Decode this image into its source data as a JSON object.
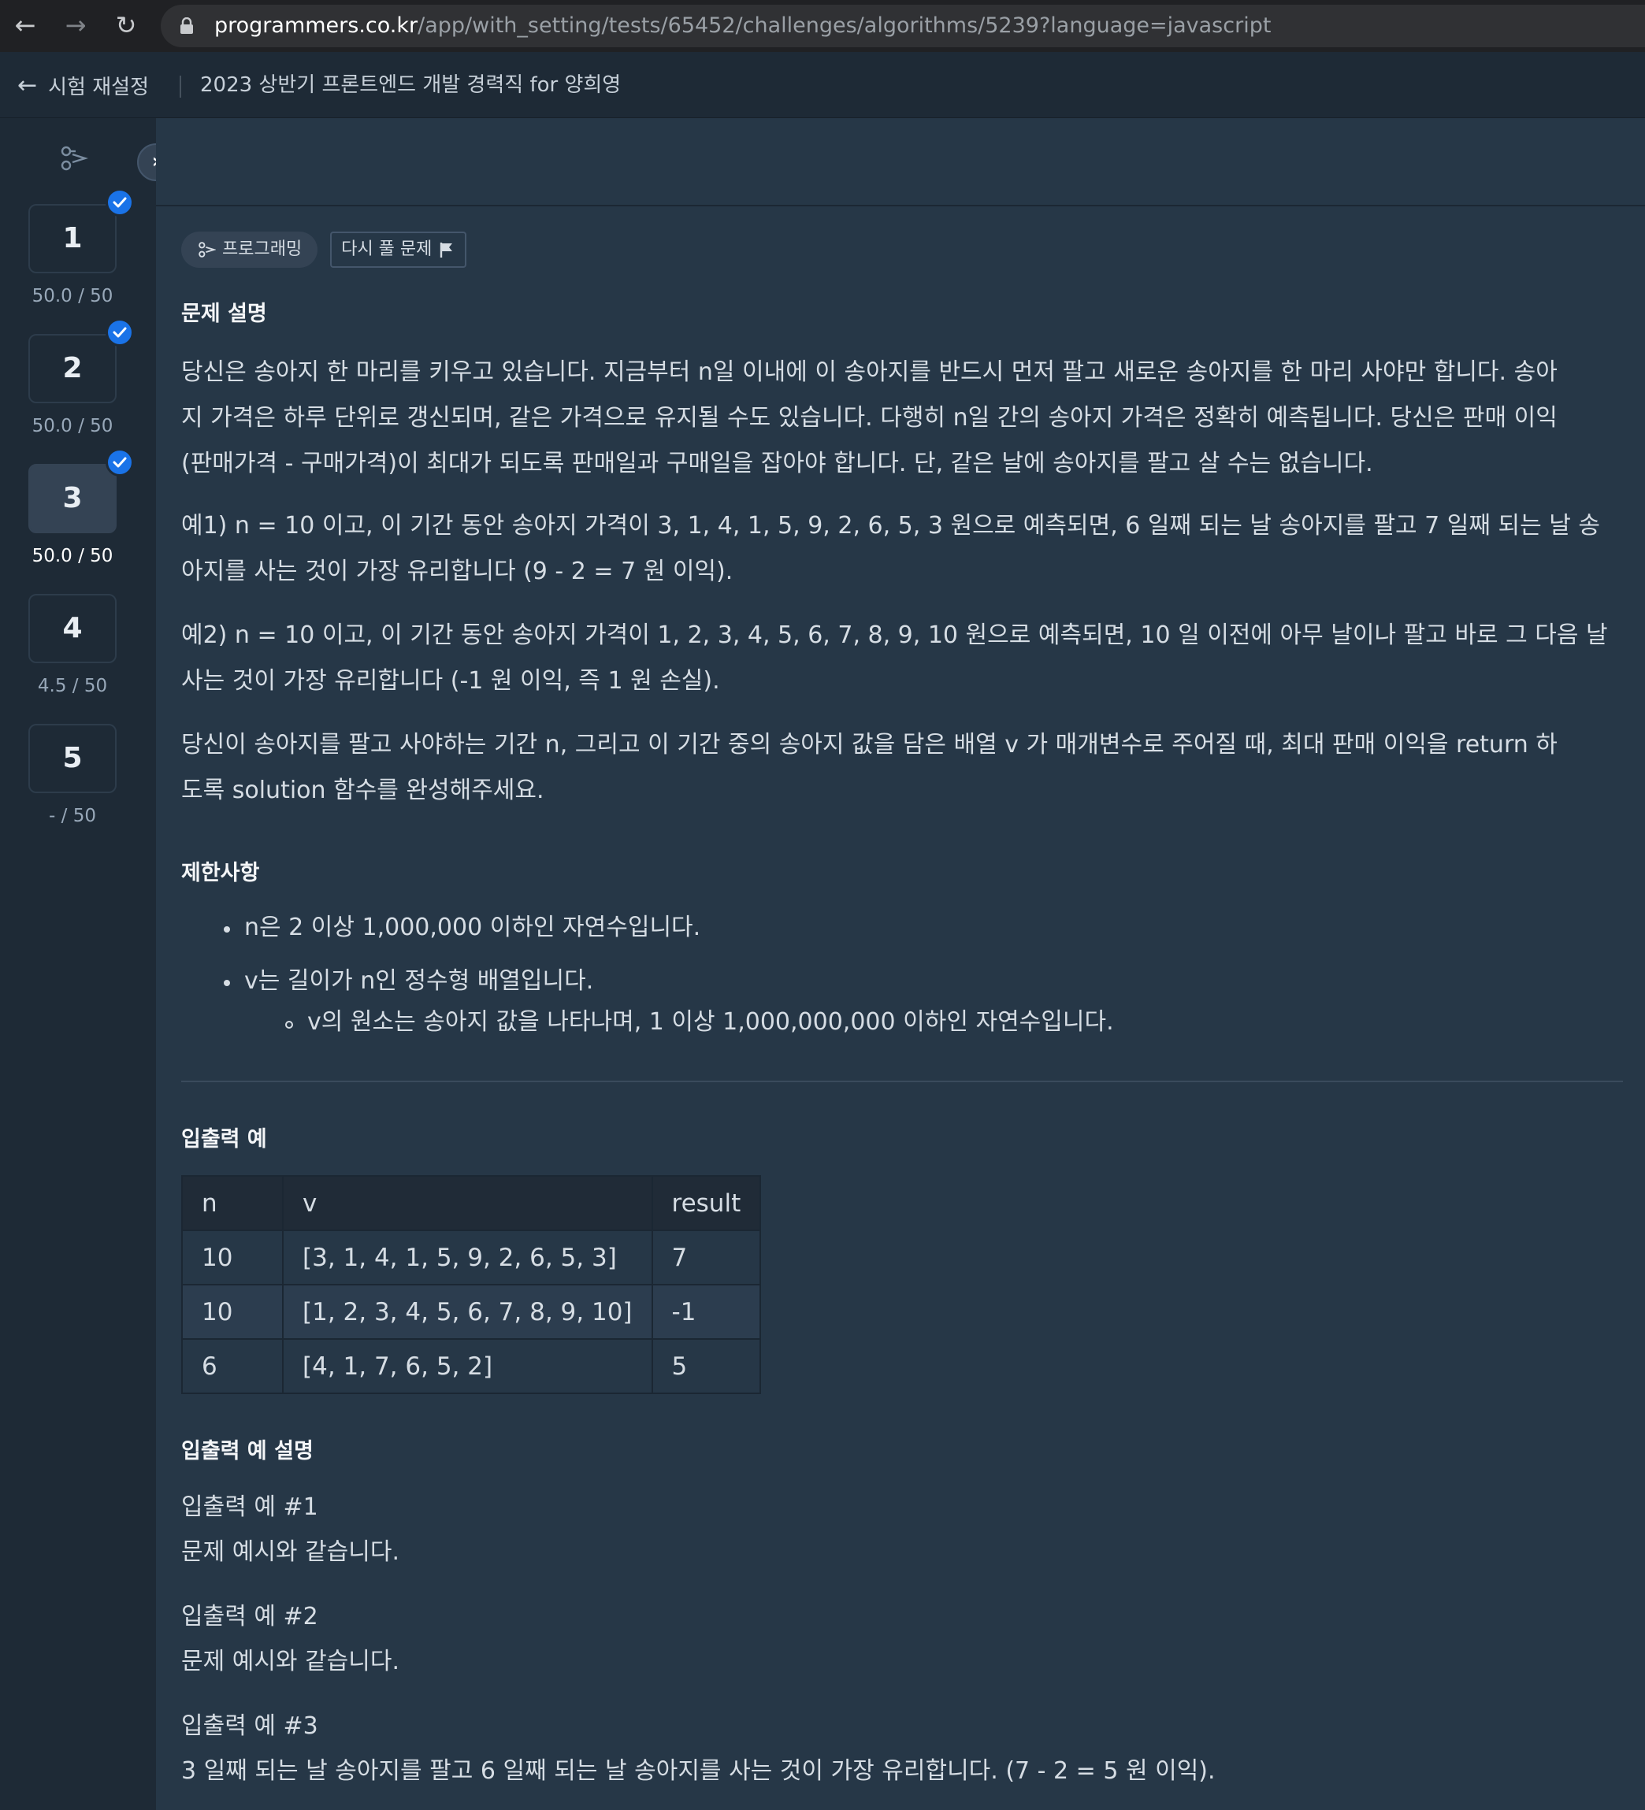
{
  "browser": {
    "url_host": "programmers.co.kr",
    "url_path": "/app/with_setting/tests/65452/challenges/algorithms/5239?language=javascript"
  },
  "header": {
    "back_label": "시험 재설정",
    "exam_title": "2023 상반기 프론트엔드 개발 경력직 for 양희영"
  },
  "sidebar": {
    "questions": [
      {
        "number": "1",
        "score": "50.0 / 50",
        "completed": true,
        "active": false
      },
      {
        "number": "2",
        "score": "50.0 / 50",
        "completed": true,
        "active": false
      },
      {
        "number": "3",
        "score": "50.0 / 50",
        "completed": true,
        "active": true
      },
      {
        "number": "4",
        "score": "4.5 / 50",
        "completed": false,
        "active": false
      },
      {
        "number": "5",
        "score": "- / 50",
        "completed": false,
        "active": false
      }
    ]
  },
  "tags": {
    "category": "프로그래밍",
    "retry": "다시 풀 문제"
  },
  "problem": {
    "title": "문제 설명",
    "lines": [
      "당신은 송아지 한 마리를 키우고 있습니다. 지금부터 n일 이내에 이 송아지를 반드시 먼저 팔고 새로운 송아지를 한 마리 사야만 합니다. 송아",
      "지 가격은 하루 단위로 갱신되며, 같은 가격으로 유지될 수도 있습니다. 다행히 n일 간의 송아지 가격은 정확히 예측됩니다. 당신은 판매 이익",
      "(판매가격 - 구매가격)이 최대가 되도록 판매일과 구매일을 잡아야 합니다. 단, 같은 날에 송아지를 팔고 살 수는 없습니다."
    ],
    "example1": [
      "예1) n = 10 이고, 이 기간 동안 송아지 가격이 3, 1, 4, 1, 5, 9, 2, 6, 5, 3 원으로 예측되면, 6 일째 되는 날 송아지를 팔고 7 일째 되는 날 송",
      "아지를 사는 것이 가장 유리합니다 (9 - 2 = 7 원 이익)."
    ],
    "example2": [
      "예2) n = 10 이고, 이 기간 동안 송아지 가격이 1, 2, 3, 4, 5, 6, 7, 8, 9, 10 원으로 예측되면, 10 일 이전에 아무 날이나 팔고 바로 그 다음 날",
      "사는 것이 가장 유리합니다 (-1 원 이익, 즉 1 원 손실)."
    ],
    "task": [
      "당신이 송아지를 팔고 사야하는 기간 n, 그리고 이 기간 중의 송아지 값을 담은 배열 v 가 매개변수로 주어질 때, 최대 판매 이익을 return 하",
      "도록 solution 함수를 완성해주세요."
    ]
  },
  "constraints": {
    "title": "제한사항",
    "items": [
      "n은 2 이상 1,000,000 이하인 자연수입니다.",
      "v는 길이가 n인 정수형 배열입니다."
    ],
    "subitem": "v의 원소는 송아지 값을 나타나며, 1 이상 1,000,000,000 이하인 자연수입니다."
  },
  "io_example": {
    "title": "입출력 예",
    "headers": [
      "n",
      "v",
      "result"
    ],
    "rows": [
      [
        "10",
        "[3, 1, 4, 1, 5, 9, 2, 6, 5, 3]",
        "7"
      ],
      [
        "10",
        "[1, 2, 3, 4, 5, 6, 7, 8, 9, 10]",
        "-1"
      ],
      [
        "6",
        "[4, 1, 7, 6, 5, 2]",
        "5"
      ]
    ]
  },
  "io_explanation": {
    "title": "입출력 예 설명",
    "items": [
      {
        "label": "입출력 예 #1",
        "text": "문제 예시와 같습니다."
      },
      {
        "label": "입출력 예 #2",
        "text": "문제 예시와 같습니다."
      },
      {
        "label": "입출력 예 #3",
        "text": "3 일째 되는 날 송아지를 팔고 6 일째 되는 날 송아지를 사는 것이 가장 유리합니다. (7 - 2 = 5 원 이익)."
      }
    ]
  },
  "colors": {
    "background": "#263747",
    "sidebar": "#1e2a36",
    "check": "#1a73e8"
  }
}
